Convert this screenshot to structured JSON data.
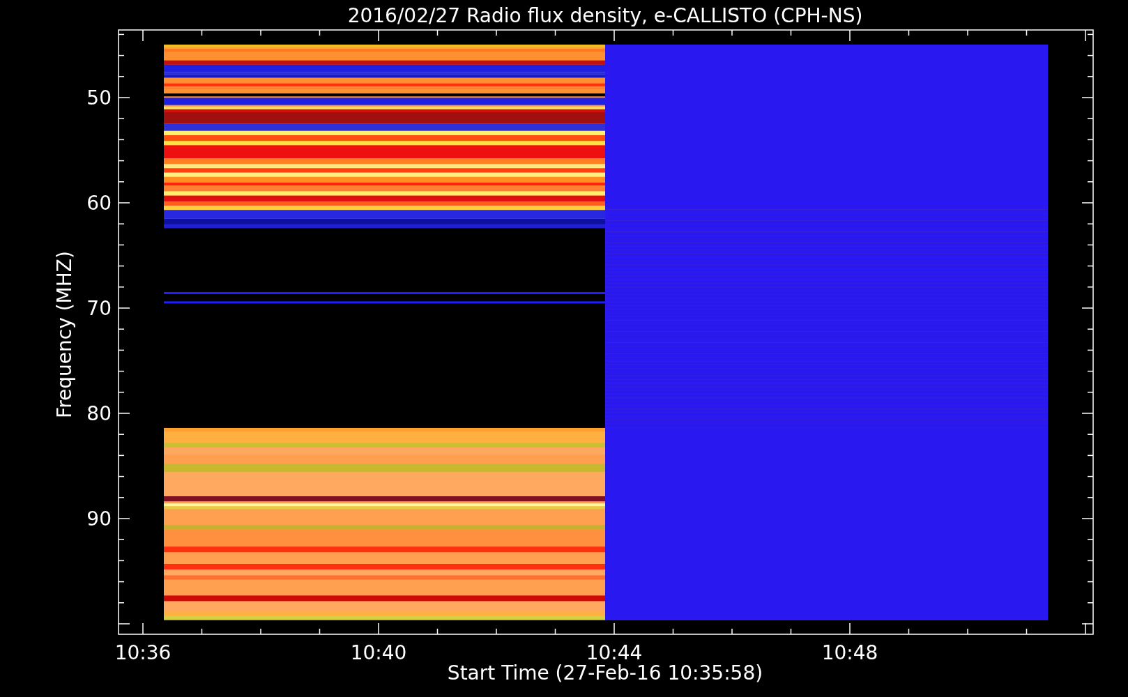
{
  "plot": {
    "title": "2016/02/27  Radio flux density, e-CALLISTO (CPH-NS)",
    "y_axis": {
      "label": "Frequency (MHZ)",
      "ticks": [
        "50",
        "60",
        "70",
        "80",
        "90"
      ]
    },
    "x_axis": {
      "label": "Start Time (27-Feb-16 10:35:58)",
      "ticks": [
        "10:36",
        "10:40",
        "10:44",
        "10:48"
      ]
    }
  }
}
